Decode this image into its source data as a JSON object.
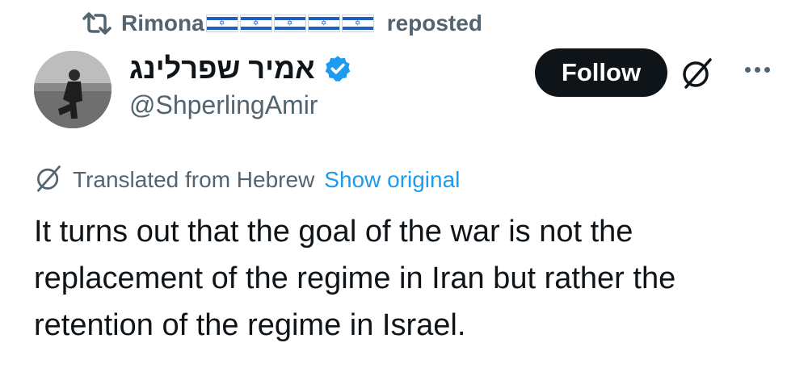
{
  "repost": {
    "icon": "repost-icon",
    "user_name": "Rimona",
    "flag_count": 5,
    "label": "reposted"
  },
  "author": {
    "display_name": "אמיר שפרלינג",
    "handle": "@ShperlingAmir",
    "verified": true,
    "verified_color": "#1d9bf0"
  },
  "actions": {
    "follow_label": "Follow",
    "grok_icon": "translate-slash-icon",
    "more_icon": "more-dots-icon"
  },
  "translation": {
    "icon": "translate-slash-icon",
    "note": "Translated from Hebrew",
    "show_original": "Show original",
    "link_color": "#1d9bf0"
  },
  "tweet": {
    "lines": [
      "It turns out that the goal of the war is not the",
      "replacement of the regime in Iran but rather the",
      "retention of the regime in Israel."
    ]
  }
}
